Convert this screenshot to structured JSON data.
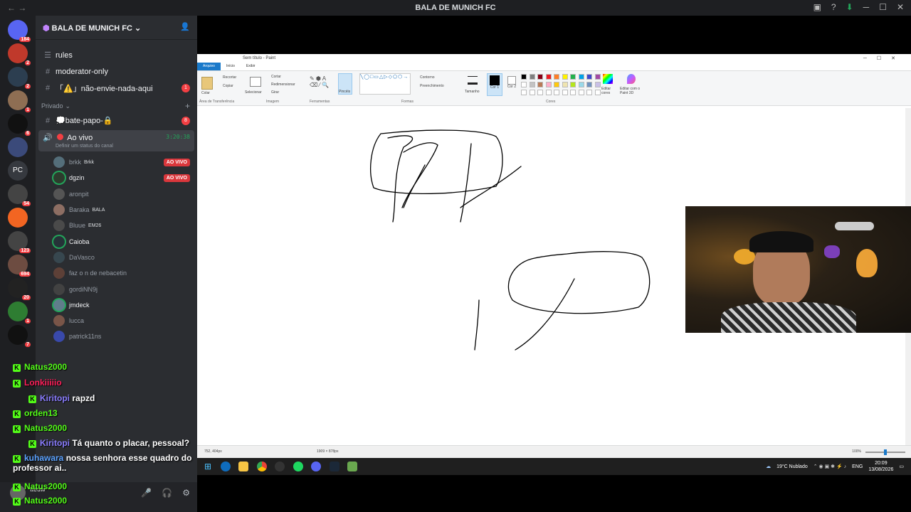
{
  "window": {
    "title": "BALA DE MUNICH FC"
  },
  "servers": [
    {
      "badge": "184",
      "color": "#5865f2"
    },
    {
      "badge": "2",
      "color": "#c0392b"
    },
    {
      "badge": "2",
      "color": "#2c3e50"
    },
    {
      "badge": "1",
      "color": "#8e6e53"
    },
    {
      "badge": "6",
      "color": "#111111"
    },
    {
      "badge": "",
      "color": "#3b4a7a"
    },
    {
      "badge": "",
      "color": "#36393f",
      "text": "PC"
    },
    {
      "badge": "54",
      "color": "#444444"
    },
    {
      "badge": "",
      "color": "#f26522"
    },
    {
      "badge": "123",
      "color": "#444444"
    },
    {
      "badge": "694",
      "color": "#6d4c41"
    },
    {
      "badge": "20",
      "color": "#222222"
    },
    {
      "badge": "1",
      "color": "#2e7d32"
    },
    {
      "badge": "7",
      "color": "#111111"
    }
  ],
  "guild": {
    "name": "BALA DE MUNICH FC"
  },
  "channels": [
    {
      "icon": "rules",
      "name": "rules",
      "badge": ""
    },
    {
      "icon": "#",
      "name": "moderator-only",
      "badge": ""
    },
    {
      "icon": "#",
      "name": "「⚠️」não-envie-nada-aqui",
      "badge": "1"
    }
  ],
  "category": {
    "name": "Privado"
  },
  "private_channels": [
    {
      "icon": "#",
      "name": "💭bate-papo-🔒",
      "badge": "8"
    }
  ],
  "voice_channel": {
    "name": "Ao vivo",
    "timer": "3:20:38",
    "status": "Definir um status do canal"
  },
  "voice_users": [
    {
      "name": "brkk",
      "tag": "Brkk",
      "live": "AO VIVO",
      "bright": false,
      "color": "#546e7a"
    },
    {
      "name": "dgzin",
      "tag": "",
      "live": "AO VIVO",
      "bright": true,
      "color": "#2d3b2d"
    },
    {
      "name": "aronpit",
      "tag": "",
      "live": "",
      "bright": false,
      "color": "#555555"
    },
    {
      "name": "Baraka",
      "tag": "BALA",
      "live": "",
      "bright": false,
      "color": "#8d6e63"
    },
    {
      "name": "Bluue",
      "tag": "EM26",
      "live": "",
      "bright": false,
      "color": "#4a4a4a"
    },
    {
      "name": "Caioba",
      "tag": "",
      "live": "",
      "bright": true,
      "color": "#263238"
    },
    {
      "name": "DaVasco",
      "tag": "",
      "live": "",
      "bright": false,
      "color": "#37474f"
    },
    {
      "name": "faz o n de nebacetin",
      "tag": "",
      "live": "",
      "bright": false,
      "color": "#5d4037"
    },
    {
      "name": "gordiNN9j",
      "tag": "",
      "live": "",
      "bright": false,
      "color": "#424242"
    },
    {
      "name": "jmdeck",
      "tag": "",
      "live": "",
      "bright": true,
      "color": "#607d8b"
    },
    {
      "name": "lucca",
      "tag": "",
      "live": "",
      "bright": false,
      "color": "#795548"
    },
    {
      "name": "patrick11ns",
      "tag": "",
      "live": "",
      "bright": false,
      "color": "#3949ab"
    }
  ],
  "chat_messages": [
    {
      "user": "Natus2000",
      "color": "#53fc18",
      "text": ""
    },
    {
      "user": "Lonkiiiiio",
      "color": "#ff1f5a",
      "text": ""
    },
    {
      "user": "Kiritopi",
      "color": "#8a7dff",
      "text": "rapzd"
    },
    {
      "user": "orden13",
      "color": "#53fc18",
      "text": ""
    },
    {
      "user": "Natus2000",
      "color": "#53fc18",
      "text": ""
    },
    {
      "user": "Kiritopi",
      "color": "#8a7dff",
      "text": "Tá quanto o placar, pessoal?"
    },
    {
      "user": "kuhawara",
      "color": "#5da3ff",
      "text": "nossa senhora esse quadro do professor ai.."
    },
    {
      "user": "Natus2000",
      "color": "#53fc18",
      "text": ""
    },
    {
      "user": "Natus2000",
      "color": "#53fc18",
      "text": ""
    }
  ],
  "paint": {
    "title": "Sem título - Paint",
    "tabs": [
      "Arquivo",
      "Início",
      "Exibir"
    ],
    "groups": [
      "Área de Transferência",
      "Imagem",
      "Ferramentas",
      "Formas",
      "Cores"
    ],
    "clipboard": {
      "paste": "Colar",
      "cut": "Recortar",
      "copy": "Copiar"
    },
    "image": {
      "select": "Selecionar",
      "crop": "Cortar",
      "resize": "Redimensionar",
      "rotate": "Girar"
    },
    "brushes": "Pincéis",
    "outline": "Contorno",
    "fill": "Preenchimento",
    "size": "Tamanho",
    "color1": "Cor 1",
    "color2": "Cor 2",
    "edit_colors": "Editar cores",
    "edit_3d": "Editar com o Paint 3D",
    "palette": [
      "#000000",
      "#7f7f7f",
      "#880015",
      "#ed1c24",
      "#ff7f27",
      "#fff200",
      "#22b14c",
      "#00a2e8",
      "#3f48cc",
      "#a349a4",
      "#ffffff",
      "#c3c3c3",
      "#b97a57",
      "#ffaec9",
      "#ffc90e",
      "#efe4b0",
      "#b5e61d",
      "#99d9ea",
      "#7092be",
      "#c8bfe7"
    ],
    "status": {
      "cursor": "752, 404px",
      "canvas_size": "1909 × 878px",
      "zoom": "100%"
    }
  },
  "taskbar": {
    "weather": "19°C Nublado",
    "lang": "ENG",
    "time": "20:09",
    "date": "13/08/2026"
  },
  "user_panel": {
    "name": "tteuw",
    "status": "Ao vivo / BALA DE MUNICH FC"
  }
}
